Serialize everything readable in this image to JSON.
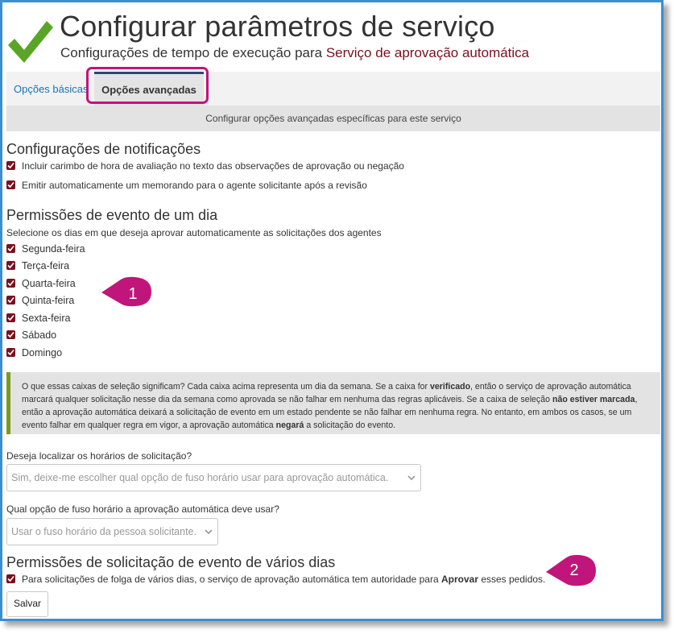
{
  "header": {
    "title": "Configurar parâmetros de serviço",
    "subtitle_prefix": "Configurações de tempo de execução para ",
    "subtitle_service": "Serviço de aprovação automática"
  },
  "tabs": [
    {
      "label": "Opções básicas",
      "active": false
    },
    {
      "label": "Opções avançadas",
      "active": true
    }
  ],
  "banner": "Configurar opções avançadas específicas para este serviço",
  "notifications": {
    "title": "Configurações de notificações",
    "options": [
      {
        "label": "Incluir carimbo de hora de avaliação no texto das observações de aprovação ou negação",
        "checked": true
      },
      {
        "label": "Emitir automaticamente um memorando para o agente solicitante após a revisão",
        "checked": true
      }
    ]
  },
  "single_day": {
    "title": "Permissões de evento de um dia",
    "instruction": "Selecione os dias em que deseja aprovar automaticamente as solicitações dos agentes",
    "days": [
      {
        "label": "Segunda-feira",
        "checked": true
      },
      {
        "label": "Terça-feira",
        "checked": true
      },
      {
        "label": "Quarta-feira",
        "checked": true
      },
      {
        "label": "Quinta-feira",
        "checked": true
      },
      {
        "label": "Sexta-feira",
        "checked": true
      },
      {
        "label": "Sábado",
        "checked": true
      },
      {
        "label": "Domingo",
        "checked": true
      }
    ]
  },
  "info": {
    "t1": "O que essas caixas de seleção significam? Cada caixa acima representa um dia da semana. Se a caixa for ",
    "b1": "verificado",
    "t2": ", então o serviço de aprovação automática marcará qualquer solicitação nesse dia da semana como aprovada se não falhar em nenhuma das regras aplicáveis. Se a caixa de seleção ",
    "b2": "não estiver marcada",
    "t3": ", então a aprovação automática deixará a solicitação de evento em um estado pendente se não falhar em nenhuma regra. No entanto, em ambos os casos, se um evento falhar em qualquer regra em vigor, a aprovação automática ",
    "b3": "negará",
    "t4": " a solicitação do evento."
  },
  "localize": {
    "question": "Deseja localizar os horários de solicitação?",
    "selected": "Sim, deixe-me escolher qual opção de fuso horário usar para aprovação automática."
  },
  "timezone": {
    "question": "Qual opção de fuso horário a aprovação automática deve usar?",
    "selected": "Usar o fuso horário da pessoa solicitante."
  },
  "multi_day": {
    "title": "Permissões de solicitação de evento de vários dias",
    "option_prefix": "Para solicitações de folga de vários dias, o serviço de aprovação automática tem autoridade para ",
    "option_bold": "Aprovar",
    "option_suffix": " esses pedidos.",
    "checked": true
  },
  "save_label": "Salvar",
  "callouts": [
    {
      "number": "1"
    },
    {
      "number": "2"
    }
  ],
  "colors": {
    "accent": "#7a1020",
    "link": "#1a73b5",
    "check_green": "#5aa527",
    "callout_magenta": "#c0157a",
    "frame_blue": "#3b8fd0",
    "info_border": "#7a9a1c"
  }
}
